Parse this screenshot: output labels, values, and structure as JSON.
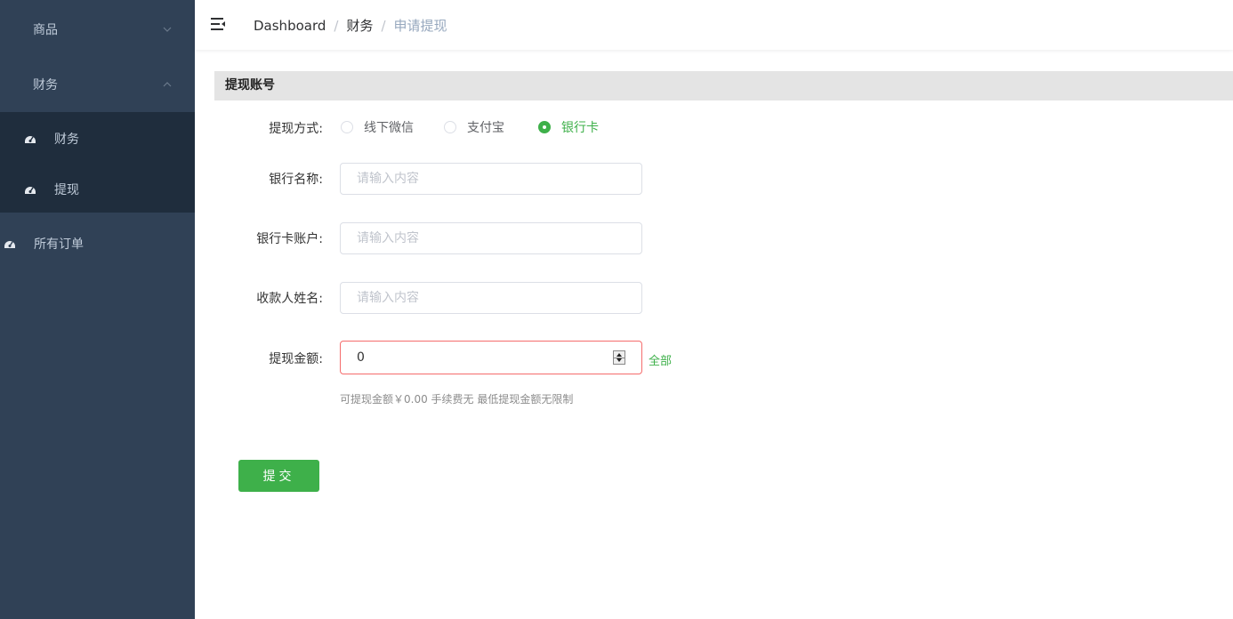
{
  "sidebar": {
    "menus": [
      {
        "label": "商品",
        "expanded": false
      },
      {
        "label": "财务",
        "expanded": true
      }
    ],
    "submenu": [
      {
        "label": "财务",
        "icon": "dashboard-icon"
      },
      {
        "label": "提现",
        "icon": "dashboard-icon"
      }
    ],
    "top_items": [
      {
        "label": "所有订单",
        "icon": "dashboard-icon"
      }
    ]
  },
  "navbar": {
    "breadcrumb": [
      "Dashboard",
      "财务",
      "申请提现"
    ],
    "separator": "/"
  },
  "section": {
    "title": "提现账号"
  },
  "form": {
    "method": {
      "label": "提现方式:",
      "options": [
        "线下微信",
        "支付宝",
        "银行卡"
      ],
      "selected": "银行卡"
    },
    "bank_name": {
      "label": "银行名称:",
      "placeholder": "请输入内容",
      "value": ""
    },
    "bank_account": {
      "label": "银行卡账户:",
      "placeholder": "请输入内容",
      "value": ""
    },
    "payee_name": {
      "label": "收款人姓名:",
      "placeholder": "请输入内容",
      "value": ""
    },
    "amount": {
      "label": "提现金额:",
      "value": "0",
      "all_label": "全部"
    },
    "hint": "可提现金额￥0.00  手续费无  最低提现金额无限制",
    "submit_label": "提交"
  },
  "colors": {
    "sidebar_bg": "#304156",
    "submenu_bg": "#1f2d3d",
    "accent": "#3eb04a",
    "error": "#f56c6c"
  }
}
